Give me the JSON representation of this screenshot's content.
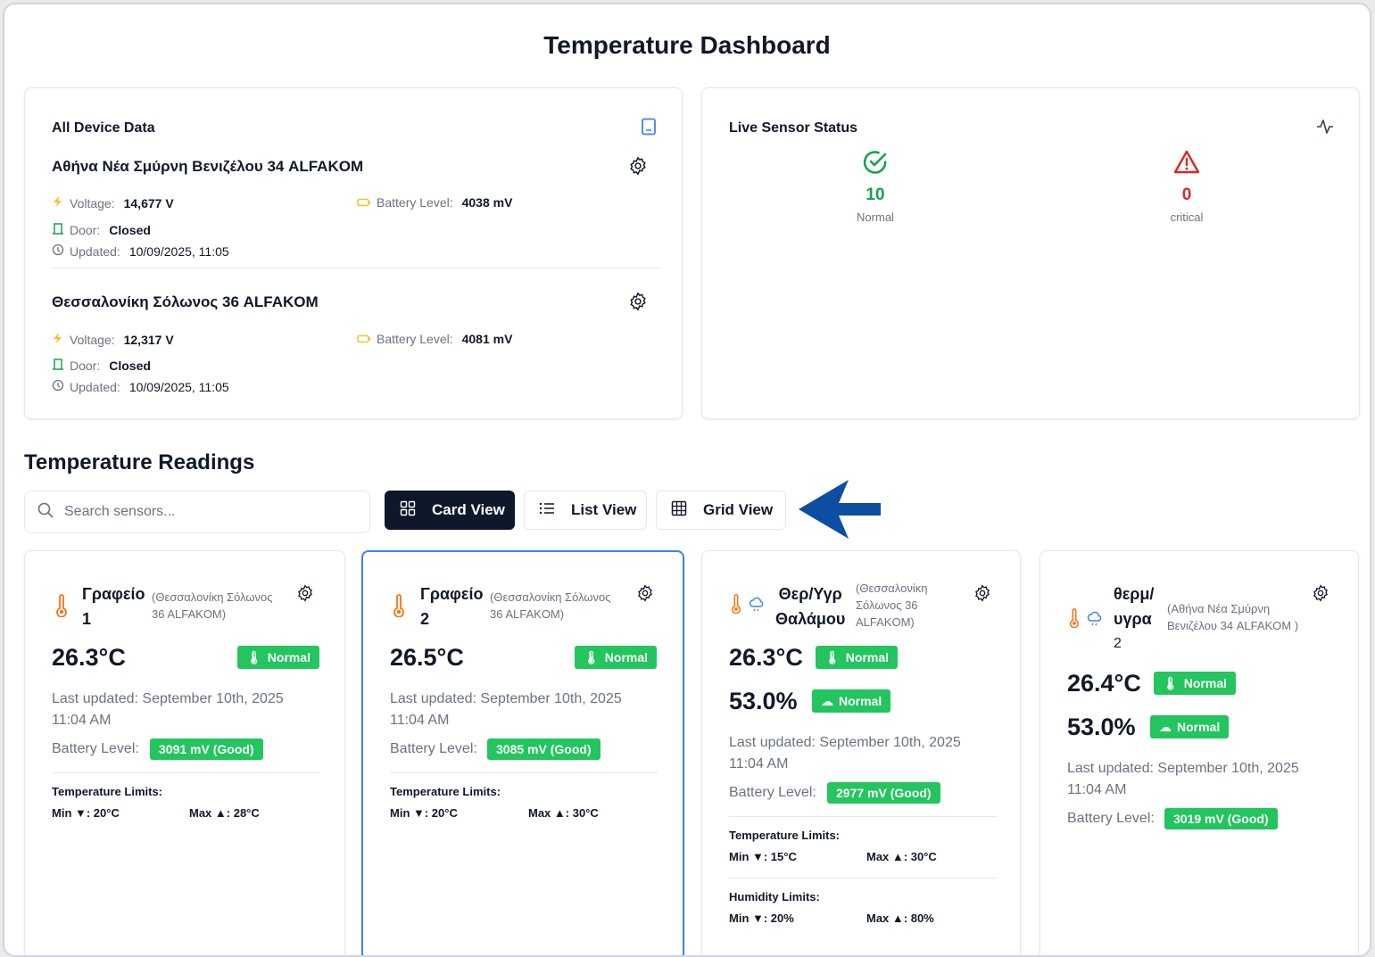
{
  "page": {
    "title": "Temperature Dashboard"
  },
  "colors": {
    "accent_dark": "#0f172a",
    "good": "#22c55e",
    "normal": "#16a34a",
    "critical": "#dc2626",
    "selected_border": "#3b82f6",
    "arrow": "#0b4ea2"
  },
  "device_panel": {
    "title": "All Device Data",
    "title_icon": "document-icon",
    "devices": [
      {
        "name": "Αθήνα Νέα Σμύρνη Βενιζέλου 34 ALFAKOM",
        "voltage_label": "Voltage:",
        "voltage": "14,677 V",
        "battery_label": "Battery Level:",
        "battery": "4038 mV",
        "door_label": "Door:",
        "door": "Closed",
        "updated_label": "Updated:",
        "updated": "10/09/2025, 11:05"
      },
      {
        "name": "Θεσσαλονίκη Σόλωνος 36 ALFAKOM",
        "voltage_label": "Voltage:",
        "voltage": "12,317 V",
        "battery_label": "Battery Level:",
        "battery": "4081 mV",
        "door_label": "Door:",
        "door": "Closed",
        "updated_label": "Updated:",
        "updated": "10/09/2025, 11:05"
      }
    ]
  },
  "live_panel": {
    "title": "Live Sensor Status",
    "title_icon": "activity-icon",
    "normal": {
      "count": "10",
      "label": "Normal"
    },
    "critical": {
      "count": "0",
      "label": "critical"
    }
  },
  "readings": {
    "title": "Temperature Readings",
    "search_placeholder": "Search sensors...",
    "views": [
      {
        "label": "Card View",
        "icon": "grid-icon",
        "active": true
      },
      {
        "label": "List View",
        "icon": "list-icon",
        "active": false
      },
      {
        "label": "Grid View",
        "icon": "table-icon",
        "active": false
      }
    ]
  },
  "cards": [
    {
      "name_line1": "Γραφείο",
      "name_line2": "1",
      "location_line1": "(Θεσσαλονίκη Σόλωνος",
      "location_line2": "36 ALFAKOM)",
      "temperature": "26.3°C",
      "temp_status": "Normal",
      "updated_line1": "Last updated: September 10th, 2025",
      "updated_line2": "11:04 AM",
      "battery_label": "Battery Level:",
      "battery": "3091 mV (Good)",
      "temp_limits_title": "Temperature Limits:",
      "temp_min": "Min ▼: 20°C",
      "temp_max": "Max ▲: 28°C"
    },
    {
      "name_line1": "Γραφείο",
      "name_line2": "2",
      "location_line1": "(Θεσσαλονίκη Σόλωνος",
      "location_line2": "36 ALFAKOM)",
      "temperature": "26.5°C",
      "temp_status": "Normal",
      "updated_line1": "Last updated: September 10th, 2025",
      "updated_line2": "11:04 AM",
      "battery_label": "Battery Level:",
      "battery": "3085 mV (Good)",
      "temp_limits_title": "Temperature Limits:",
      "temp_min": "Min ▼: 20°C",
      "temp_max": "Max ▲: 30°C"
    },
    {
      "name_line1": "Θερ/Υγρ",
      "name_line2": "Θαλάμου",
      "location_line1": "(Θεσσαλονίκη",
      "location_line2": "Σόλωνος 36",
      "location_line3": "ALFAKOM)",
      "temperature": "26.3°C",
      "temp_status": "Normal",
      "humidity": "53.0%",
      "hum_status": "Normal",
      "updated_line1": "Last updated: September 10th, 2025",
      "updated_line2": "11:04 AM",
      "battery_label": "Battery Level:",
      "battery": "2977 mV (Good)",
      "temp_limits_title": "Temperature Limits:",
      "temp_min": "Min ▼: 15°C",
      "temp_max": "Max ▲: 30°C",
      "hum_limits_title": "Humidity Limits:",
      "hum_min": "Min ▼: 20%",
      "hum_max": "Max ▲: 80%"
    },
    {
      "name_line1": "θερμ/",
      "name_line2": "υγρα",
      "name_line3": "2",
      "location_line1": "(Αθήνα Νέα Σμύρνη",
      "location_line2": "Βενιζέλου 34 ALFAKOM )",
      "temperature": "26.4°C",
      "temp_status": "Normal",
      "humidity": "53.0%",
      "hum_status": "Normal",
      "updated_line1": "Last updated: September 10th, 2025",
      "updated_line2": "11:04 AM",
      "battery_label": "Battery Level:",
      "battery": "3019 mV (Good)"
    }
  ]
}
